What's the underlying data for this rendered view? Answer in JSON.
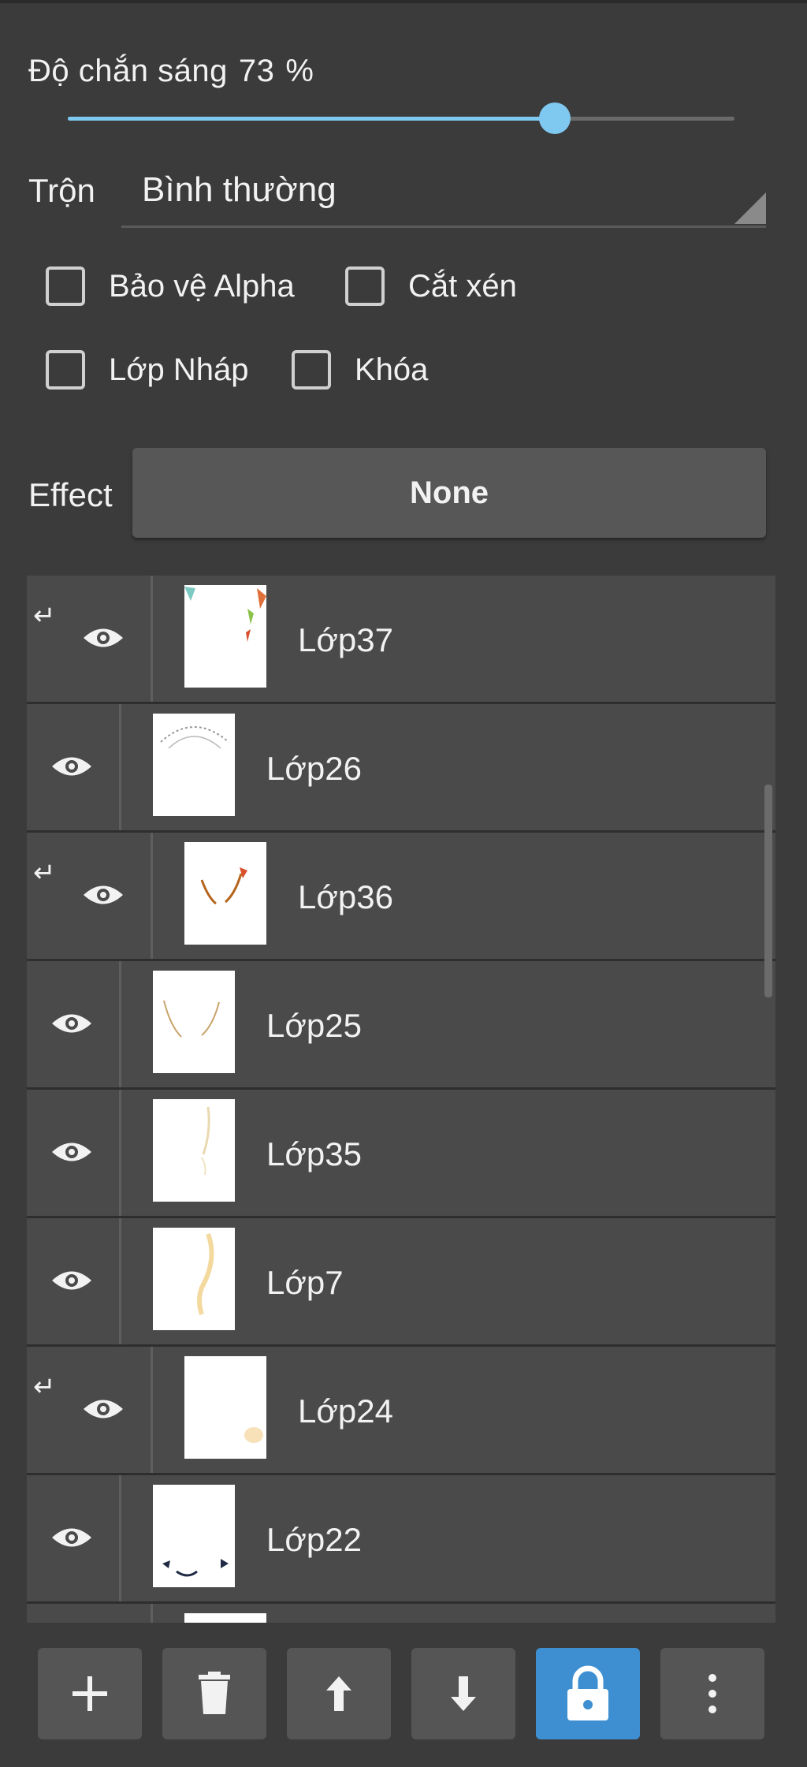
{
  "opacity": {
    "label": "Độ chắn sáng",
    "value": "73",
    "unit": "%",
    "level": 0.73
  },
  "blend": {
    "label": "Trộn",
    "value": "Bình thường"
  },
  "options": {
    "protect_alpha": "Bảo vệ Alpha",
    "clipping": "Cắt xén",
    "draft_layer": "Lớp Nháp",
    "lock": "Khóa"
  },
  "effect": {
    "label": "Effect",
    "value": "None"
  },
  "layers": [
    {
      "name": "Lớp37",
      "clipped": true,
      "visible": true
    },
    {
      "name": "Lớp26",
      "clipped": false,
      "visible": true
    },
    {
      "name": "Lớp36",
      "clipped": true,
      "visible": true
    },
    {
      "name": "Lớp25",
      "clipped": false,
      "visible": true
    },
    {
      "name": "Lớp35",
      "clipped": false,
      "visible": true
    },
    {
      "name": "Lớp7",
      "clipped": false,
      "visible": true
    },
    {
      "name": "Lớp24",
      "clipped": true,
      "visible": true
    },
    {
      "name": "Lớp22",
      "clipped": false,
      "visible": true
    }
  ],
  "toolbar": [
    "plus-icon",
    "trash-icon",
    "arrow-up-icon",
    "arrow-down-icon",
    "lock-icon",
    "more-icon"
  ],
  "colors": {
    "accent": "#7fc8f0",
    "active_button": "#3d8fd1",
    "row": "#4a4a4a"
  }
}
